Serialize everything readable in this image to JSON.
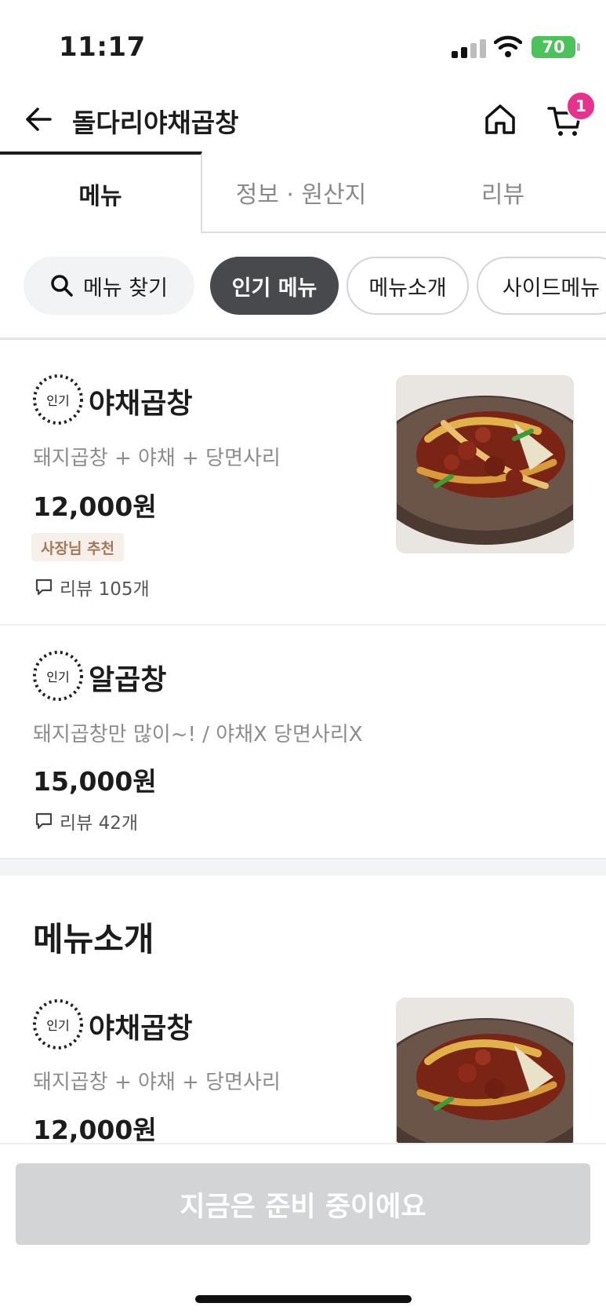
{
  "status_bar": {
    "time": "11:17",
    "battery": "70"
  },
  "header": {
    "title": "돌다리야채곱창",
    "cart_count": "1"
  },
  "tabs": [
    {
      "label": "메뉴",
      "active": true
    },
    {
      "label": "정보 · 원산지",
      "active": false
    },
    {
      "label": "리뷰",
      "active": false
    }
  ],
  "chips": {
    "search": "메뉴 찾기",
    "items": [
      "인기 메뉴",
      "메뉴소개",
      "사이드메뉴"
    ],
    "selected": "인기 메뉴"
  },
  "popular_badge": "인기",
  "popular_items": [
    {
      "name": "야채곱창",
      "desc": "돼지곱창 + 야채 + 당면사리",
      "price": "12,000원",
      "tag": "사장님 추천",
      "review": "리뷰 105개"
    },
    {
      "name": "알곱창",
      "desc": "돼지곱창만 많이~! / 야채X 당면사리X",
      "price": "15,000원",
      "review": "리뷰 42개"
    }
  ],
  "menu_intro": {
    "title": "메뉴소개",
    "items": [
      {
        "name": "야채곱창",
        "desc": "돼지곱창 + 야채 + 당면사리",
        "price": "12,000원"
      }
    ]
  },
  "bottom": {
    "button_label": "지금은 준비 중이에요"
  },
  "colors": {
    "cart_badge": "#e6318d",
    "active_chip": "#47494c",
    "battery": "#4cc35a",
    "owner_tag_bg": "#f7efe9",
    "owner_tag_text": "#a1785b"
  }
}
